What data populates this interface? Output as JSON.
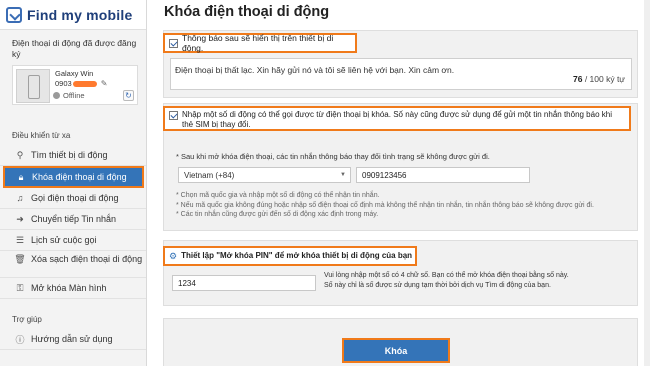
{
  "logo": {
    "text": "Find my mobile"
  },
  "sidebar": {
    "device_title": "Điện thoại di động đã được đăng ký",
    "device": {
      "name": "Galaxy Win",
      "number_prefix": "0903",
      "status": "Offline"
    },
    "remote_section": "Điều khiển từ xa",
    "items": [
      {
        "label": "Tìm thiết bị di động",
        "icon": "search-icon"
      },
      {
        "label": "Khóa điện thoại di động",
        "icon": "lock-icon"
      },
      {
        "label": "Gọi điện thoại di động",
        "icon": "music-note-icon"
      },
      {
        "label": "Chuyển tiếp Tin nhắn",
        "icon": "forward-arrow-icon"
      },
      {
        "label": "Lịch sử cuộc gọi",
        "icon": "list-icon"
      },
      {
        "label": "Xóa sạch điện thoại di động",
        "icon": "trash-icon"
      },
      {
        "label": "Mở khóa Màn hình",
        "icon": "key-icon"
      }
    ],
    "help_section": "Trợ giúp",
    "help_items": [
      {
        "label": "Hướng dẫn sử dụng",
        "icon": "help-circle-icon"
      }
    ]
  },
  "main": {
    "title": "Khóa điện thoại di động",
    "notify": {
      "checkbox_label": "Thông báo sau sẽ hiển thị trên thiết bị di động.",
      "message": "Điện thoại bị thất lạc. Xin hãy gửi nó và tôi sẽ liên hệ với bạn. Xin cảm ơn.",
      "count": "76",
      "max": " / 100 ký tự"
    },
    "phone": {
      "checkbox_label": "Nhập một số di động có thể gọi được từ điện thoại bị khóa. Số này cũng được sử dụng để gửi một tin nhắn thông báo khi thẻ SIM bị thay đổi.",
      "sim_note": "* Sau khi mở khóa điện thoại, các tin nhắn thông báo thay đổi tình trạng sẽ không được gửi đi.",
      "country": "Vietnam (+84)",
      "number": "0909123456",
      "notes": [
        "* Chọn mã quốc gia và nhập một số di động có thể nhận tin nhắn.",
        "* Nếu mã quốc gia không đúng hoặc nhập số điện thoại cố định mà không thể nhận tin nhắn, tin nhắn thông báo sẽ không được gửi đi.",
        "* Các tin nhắn cũng được gửi đến số di động xác định trong máy."
      ]
    },
    "pin": {
      "label": "Thiết lập \"Mở khóa PIN\" để mở khóa thiết bị di động của bạn",
      "value": "1234",
      "help_line1": "Vui lòng nhập một số có 4 chữ số. Bạn có thể mở khóa điện thoại bằng số này.",
      "help_line2": "Số này chỉ là số được sử dụng tạm thời bởi dịch vụ Tìm di động của bạn."
    },
    "lock_button": "Khóa"
  },
  "colors": {
    "accent": "#3474b8",
    "highlight": "#f07a1a",
    "mask": "#ff7a2f"
  }
}
